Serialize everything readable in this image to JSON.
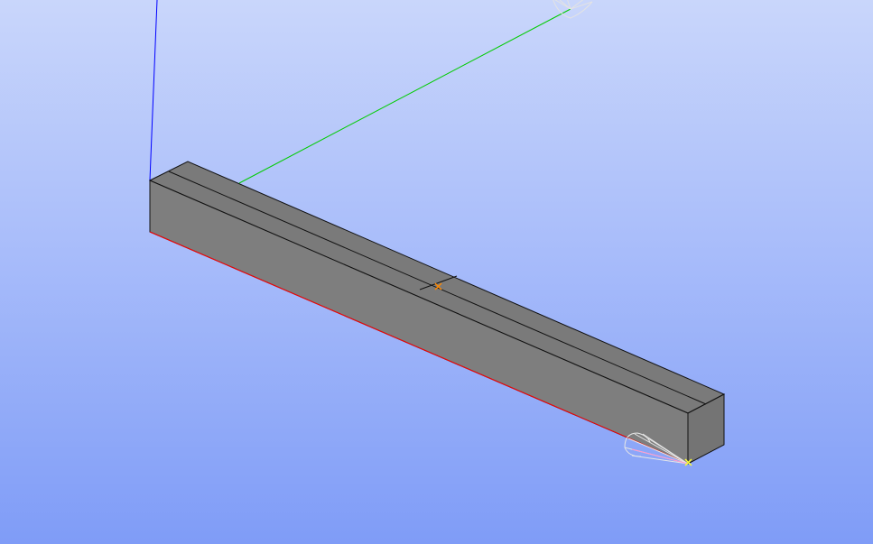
{
  "viewport": {
    "background_top": "#c9d6fb",
    "background_bottom": "#7f9cf7"
  },
  "axes": {
    "x_color": "#ff0000",
    "y_color": "#00cc00",
    "z_color": "#0000ff"
  },
  "model": {
    "shape": "rectangular-beam",
    "top_face_color": "#7a7a7a",
    "front_face_color": "#7d7d7d",
    "end_face_color": "#767676",
    "edge_color": "#111111"
  },
  "markers": {
    "center_marker_color": "#ff8800",
    "selected_vertex_color": "#ffff33",
    "light_cone_icon": "light-cone-icon"
  }
}
